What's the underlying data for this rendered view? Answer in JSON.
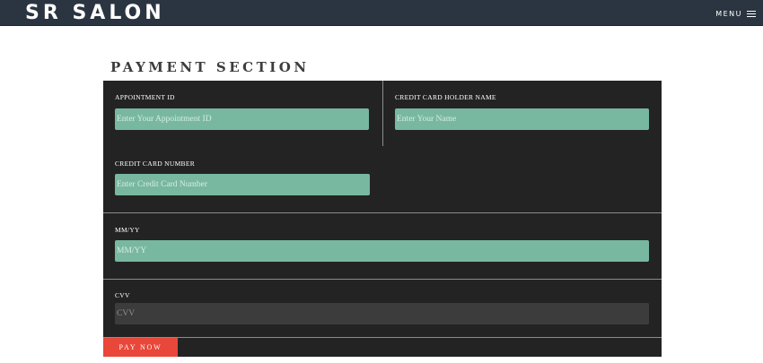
{
  "navbar": {
    "brand": "SR SALON",
    "menu_label": "MENU",
    "menu_icon": "hamburger-icon"
  },
  "payment": {
    "title": "PAYMENT SECTION",
    "fields": {
      "appointment_id": {
        "label": "APPOINTMENT ID",
        "placeholder": "Enter Your Appointment ID",
        "value": ""
      },
      "holder_name": {
        "label": "CREDIT CARD HOLDER NAME",
        "placeholder": "Enter Your Name",
        "value": ""
      },
      "card_number": {
        "label": "CREDIT CARD NUMBER",
        "placeholder": "Enter Credit Card Number",
        "value": ""
      },
      "expiry": {
        "label": "MM/YY",
        "placeholder": "MM/YY",
        "value": ""
      },
      "cvv": {
        "label": "CVV",
        "placeholder": "CVV",
        "value": ""
      }
    },
    "submit_label": "PAY NOW"
  },
  "colors": {
    "navbar_bg": "#2b3541",
    "form_bg": "#232323",
    "input_bg": "#78b8a0",
    "cvv_input_bg": "#3c3c3c",
    "button_bg": "#e8473a"
  }
}
